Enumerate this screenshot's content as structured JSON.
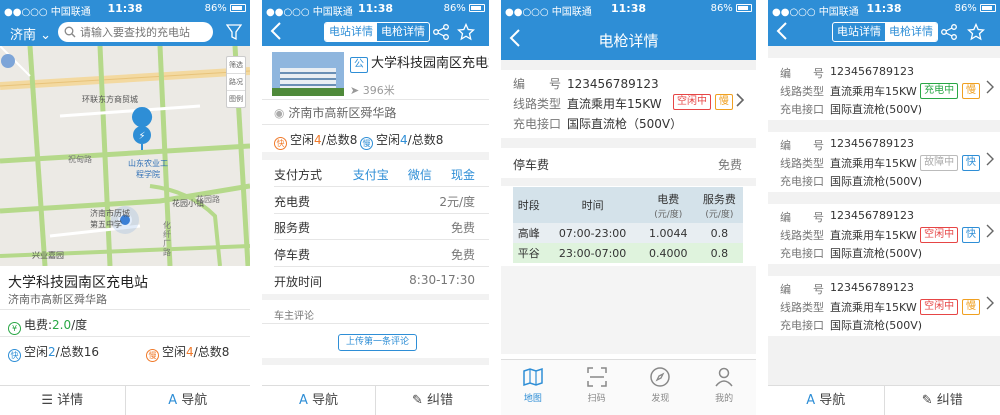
{
  "status_bar": {
    "carrier": "●●○○○ 中国联通",
    "time": "11:38",
    "battery": "86%"
  },
  "panel1": {
    "city": "济南",
    "search_placeholder": "请输入要查找的充电站",
    "map_tools": [
      "筛选",
      "路况",
      "图例"
    ],
    "map_labels": [
      "环联东方商贸城",
      "山东农业工程学院",
      "花园小镇",
      "济南市历城第五中学",
      "兴业嘉园",
      "化纤厂路",
      "花园路",
      "祝甸路"
    ],
    "station_name": "大学科技园南区充电站",
    "station_address": "济南市高新区舜华路",
    "price_label": "电费:",
    "price_value": "2.0",
    "price_unit": "/度",
    "fast_icon": "快",
    "fast_label": "空闲",
    "fast_free": "2",
    "fast_total": "/总数16",
    "slow_icon": "慢",
    "slow_label": "空闲",
    "slow_free": "4",
    "slow_total": "/总数8",
    "detail_button": "详情",
    "nav_button": "导航"
  },
  "panel2": {
    "tab_station": "电站详情",
    "tab_gun": "电枪详情",
    "public_badge": "公",
    "station_name": "大学科技园南区充电站",
    "distance": "396米",
    "address": "济南市高新区舜华路",
    "fast_icon": "快",
    "fast_label": "空闲",
    "fast_free": "4",
    "fast_total": "/总数8",
    "slow_icon": "慢",
    "slow_label": "空闲",
    "slow_free": "4",
    "slow_total": "/总数8",
    "payment_label": "支付方式",
    "payment_methods": [
      "支付宝",
      "微信",
      "现金"
    ],
    "charge_fee_label": "充电费",
    "charge_fee_value": "2元/度",
    "service_fee_label": "服务费",
    "service_fee_value": "免费",
    "parking_fee_label": "停车费",
    "parking_fee_value": "免费",
    "hours_label": "开放时间",
    "hours_value": "8:30-17:30",
    "reviews_label": "车主评论",
    "first_review_button": "上传第一条评论",
    "nav_button": "导航",
    "correct_button": "纠错"
  },
  "panel3": {
    "title": "电枪详情",
    "id_label": "编　　号",
    "id_value": "123456789123",
    "line_label": "线路类型",
    "line_value": "直流乘用车15KW",
    "status_tag": "空闲中",
    "speed_tag": "慢",
    "port_label": "充电接口",
    "port_value": "国际直流枪（500V）",
    "parking_label": "停车费",
    "parking_value": "免费",
    "table_headers": [
      "时段",
      "时间",
      "电费",
      "服务费"
    ],
    "table_units": [
      "",
      "",
      "(元/度)",
      "(元/度)"
    ],
    "table_rows": [
      [
        "高峰",
        "07:00-23:00",
        "1.0044",
        "0.8"
      ],
      [
        "平谷",
        "23:00-07:00",
        "0.4000",
        "0.8"
      ]
    ],
    "tabs": [
      "地图",
      "扫码",
      "发现",
      "我的"
    ]
  },
  "panel4": {
    "tab_station": "电站详情",
    "tab_gun": "电枪详情",
    "id_label": "编　　号",
    "line_label": "线路类型",
    "port_label": "充电接口",
    "guns": [
      {
        "id": "123456789123",
        "line": "直流乘用车15KW",
        "port": "国际直流枪(500V)",
        "status": "充电中",
        "speed": "慢"
      },
      {
        "id": "123456789123",
        "line": "直流乘用车15KW",
        "port": "国际直流枪(500V)",
        "status": "故障中",
        "speed": "快"
      },
      {
        "id": "123456789123",
        "line": "直流乘用车15KW",
        "port": "国际直流枪(500V)",
        "status": "空闲中",
        "speed": "快"
      },
      {
        "id": "123456789123",
        "line": "直流乘用车15KW",
        "port": "国际直流枪(500V)",
        "status": "空闲中",
        "speed": "慢"
      }
    ],
    "nav_button": "导航",
    "correct_button": "纠错"
  },
  "colors": {
    "primary": "#2e8ed6",
    "green": "#29a745",
    "orange": "#f07a2a",
    "red": "#e64545"
  }
}
